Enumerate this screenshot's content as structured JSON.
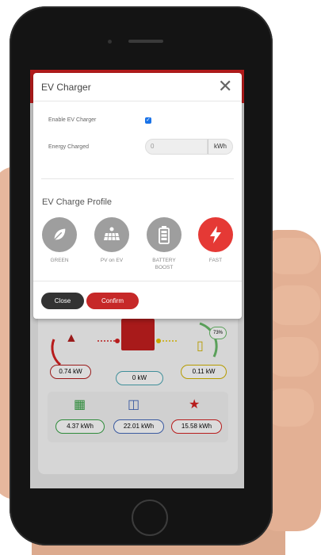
{
  "modal": {
    "title": "EV Charger",
    "close_icon": "close-icon",
    "enable_label": "Enable EV Charger",
    "enable_checked": true,
    "energy_label": "Energy Charged",
    "energy_value": "0",
    "energy_unit": "kWh",
    "profile_section_title": "EV Charge Profile",
    "profiles": [
      {
        "label": "GREEN",
        "icon": "leaf-icon",
        "active": false
      },
      {
        "label": "PV on EV",
        "icon": "solar-panel-icon",
        "active": false
      },
      {
        "label": "BATTERY BOOST",
        "icon": "battery-icon",
        "active": false
      },
      {
        "label": "FAST",
        "icon": "lightning-icon",
        "active": true
      }
    ],
    "close_button": "Close",
    "confirm_button": "Confirm"
  },
  "background_app": {
    "grid_power": "0.74 kW",
    "ev_power": "0 kW",
    "battery_power": "0.11 kW",
    "battery_percent": "73%",
    "solar_energy": "4.37 kWh",
    "home_energy": "22.01 kWh",
    "grid_energy": "15.58 kWh"
  },
  "colors": {
    "brand_red": "#c62828",
    "fast_red": "#e53935",
    "inactive_gray": "#9e9e9e",
    "close_dark": "#333333",
    "checkbox_blue": "#1a73e8"
  }
}
